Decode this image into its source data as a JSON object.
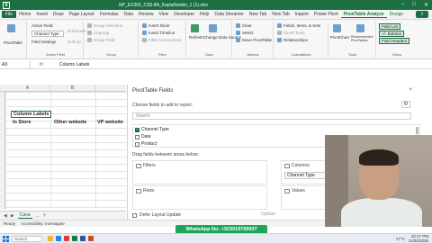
{
  "window": {
    "title": "NP_EX365_CS5-8A_KaylaRankin_1 (1).xlsx",
    "logo": "X"
  },
  "tabs": [
    "File",
    "Home",
    "Insert",
    "Draw",
    "Page Layout",
    "Formulas",
    "Data",
    "Review",
    "View",
    "Developer",
    "Help",
    "Data Streamer",
    "New Tab",
    "New Tab",
    "Inquire",
    "Power Pivot",
    "PivotTable Analyze",
    "Design"
  ],
  "ribbon": {
    "pivottable": "PivotTable",
    "active_field_label": "Active Field:",
    "active_field_value": "Channel Type",
    "field_settings": "Field Settings",
    "drill_down": "Drill Down",
    "drill_up": "Drill Up",
    "group_selection": "Group Selection",
    "ungroup": "Ungroup",
    "group_field": "Group Field",
    "insert_slicer": "Insert Slicer",
    "insert_timeline": "Insert Timeline",
    "filter_connections": "Filter Connections",
    "refresh": "Refresh",
    "change_data_source": "Change Data Source",
    "clear": "Clear",
    "select": "Select",
    "move_pivottable": "Move PivotTable",
    "fields_items_sets": "Fields, Items, & Sets",
    "olap_tools": "OLAP Tools",
    "relationships": "Relationships",
    "pivotchart": "PivotChart",
    "recommended_pivottables": "Recommended PivotTables",
    "field_list": "Field List",
    "plus_minus_buttons": "+/- Buttons",
    "field_headers": "Field Headers",
    "groups": [
      "Active Field",
      "Group",
      "Filter",
      "Data",
      "Actions",
      "Calculations",
      "Tools",
      "Show"
    ]
  },
  "formula_bar": {
    "name_box": "A3",
    "fx": "fx",
    "content": "Column Labels"
  },
  "grid": {
    "col_a": "A",
    "col_b": "B",
    "column_labels": "Column Labels",
    "in_store": "In Store",
    "other_website": "Other website",
    "vp_website": "VP website"
  },
  "sheet_bar": {
    "nav_prev": "◀",
    "nav_next": "▶",
    "active_sheet": "Cana",
    "more": "...",
    "add": "+"
  },
  "status_bar": {
    "ready": "Ready",
    "accessibility": "Accessibility: Investigate"
  },
  "pivot_pane": {
    "title": "PivotTable Fields",
    "close": "×",
    "subtitle": "Choose fields to add to report:",
    "settings_icon": "⚙",
    "search_placeholder": "Search",
    "fields": [
      {
        "name": "Channel Type",
        "checked": true,
        "mark": "✓"
      },
      {
        "name": "Date",
        "checked": false,
        "mark": ""
      },
      {
        "name": "Product",
        "checked": false,
        "mark": ""
      }
    ],
    "drag_hint": "Drag fields between areas below:",
    "areas": {
      "filters": "Filters",
      "columns": "Columns",
      "columns_item": "Channel Type",
      "rows": "Rows",
      "values": "Values"
    },
    "defer_label": "Defer Layout Update",
    "update_label": "Update"
  },
  "banner": "WhatsApp No: +923019769937",
  "taskbar": {
    "search": "Search",
    "weather": "17°C",
    "time": "10:17 PM",
    "date": "11/03/2025"
  }
}
